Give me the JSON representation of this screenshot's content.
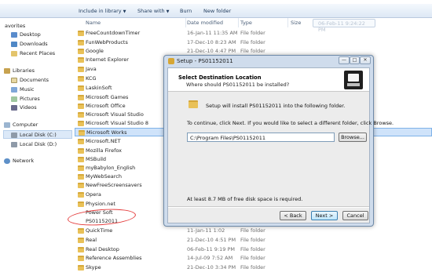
{
  "toolbar": {
    "include_label": "Include in library",
    "share_label": "Share with",
    "burn_label": "Burn",
    "new_folder_label": "New folder"
  },
  "columns": {
    "name": "Name",
    "date": "Date modified",
    "type": "Type",
    "size": "Size"
  },
  "tooltip_text": "06-Feb-11 9:24:22 PM",
  "nav": {
    "favorites": "avorites",
    "desktop": "Desktop",
    "downloads": "Downloads",
    "recent": "Recent Places",
    "libraries": "Libraries",
    "documents": "Documents",
    "music": "Music",
    "pictures": "Pictures",
    "videos": "Videos",
    "computer": "Computer",
    "local_c": "Local Disk (C:)",
    "local_d": "Local Disk (D:)",
    "network": "Network"
  },
  "files": [
    {
      "name": "FreeCountdownTimer",
      "date": "16-Jan-11 11:35 AM",
      "type": "File folder"
    },
    {
      "name": "FunWebProducts",
      "date": "17-Dec-10 8:23 AM",
      "type": "File folder"
    },
    {
      "name": "Google",
      "date": "21-Dec-10 4:47 PM",
      "type": "File folder"
    },
    {
      "name": "Internet Explorer",
      "date": "",
      "type": ""
    },
    {
      "name": "Java",
      "date": "",
      "type": ""
    },
    {
      "name": "KCG",
      "date": "",
      "type": ""
    },
    {
      "name": "LaskinSoft",
      "date": "",
      "type": ""
    },
    {
      "name": "Microsoft Games",
      "date": "",
      "type": ""
    },
    {
      "name": "Microsoft Office",
      "date": "",
      "type": ""
    },
    {
      "name": "Microsoft Visual Studio",
      "date": "",
      "type": ""
    },
    {
      "name": "Microsoft Visual Studio 8",
      "date": "",
      "type": ""
    },
    {
      "name": "Microsoft Works",
      "date": "",
      "type": ""
    },
    {
      "name": "Microsoft.NET",
      "date": "",
      "type": ""
    },
    {
      "name": "Mozilla Firefox",
      "date": "",
      "type": ""
    },
    {
      "name": "MSBuild",
      "date": "",
      "type": ""
    },
    {
      "name": "myBabylon_English",
      "date": "",
      "type": ""
    },
    {
      "name": "MyWebSearch",
      "date": "",
      "type": ""
    },
    {
      "name": "NewFreeScreensavers",
      "date": "",
      "type": ""
    },
    {
      "name": "Opera",
      "date": "",
      "type": ""
    },
    {
      "name": "Physion.net",
      "date": "",
      "type": ""
    },
    {
      "name": "Power Soft",
      "date": "",
      "type": ""
    },
    {
      "name": "PS01152011",
      "date": "",
      "type": ""
    },
    {
      "name": "QuickTime",
      "date": "11-Jan-11 1:02",
      "type": "File folder"
    },
    {
      "name": "Real",
      "date": "21-Dec-10 4:51 PM",
      "type": "File folder"
    },
    {
      "name": "Real Desktop",
      "date": "06-Feb-11 9:19 PM",
      "type": "File folder"
    },
    {
      "name": "Reference Assemblies",
      "date": "14-Jul-09 7:52 AM",
      "type": "File folder"
    },
    {
      "name": "Skype",
      "date": "21-Dec-10 3:34 PM",
      "type": "File folder"
    }
  ],
  "dialog": {
    "title": "Setup - PS01152011",
    "min_glyph": "—",
    "max_glyph": "□",
    "close_glyph": "✕",
    "heading": "Select Destination Location",
    "subheading": "Where should PS01152011 be installed?",
    "install_text": "Setup will install PS01152011 into the following folder.",
    "continue_text": "To continue, click Next. If you would like to select a different folder, click Browse.",
    "path_value": "C:\\Program Files\\PS01152011",
    "browse_label": "Browse...",
    "space_text": "At least 8.7 MB of free disk space is required.",
    "back_label": "< Back",
    "next_label": "Next >",
    "cancel_label": "Cancel"
  },
  "colors": {
    "dialog_bg": "#cfdcec",
    "highlight_row": "#cfe3fa",
    "annotation_red": "#e43b3b",
    "folder_yellow": "#e9c158"
  }
}
